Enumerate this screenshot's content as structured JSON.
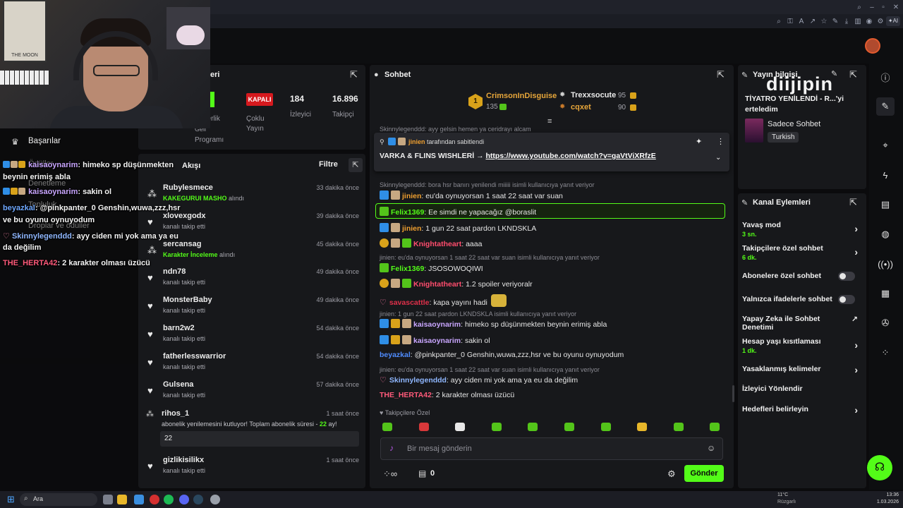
{
  "colors": {
    "accent": "#53fc18",
    "kapali": "#d6191e",
    "mod": "#2f8ee6",
    "vip": "#d9a21a"
  },
  "overlay": {
    "achievements": "Başarılar",
    "menu_faded": [
      "Ödüller",
      "Denetleme",
      "Topluluk",
      "Droplar ve ödüller"
    ],
    "chat": [
      {
        "user": "kaisaoynarim",
        "text": ": himeko sp düşünmekten",
        "cont": "beynin erimiş abla",
        "color": "#c9a6ff"
      },
      {
        "user": "kaisaoynarim",
        "text": ": sakin ol",
        "color": "#c9a6ff"
      },
      {
        "user": "beyazkal",
        "text": ": @pinkpanter_0 Genshin,wuwa,zzz,hsr",
        "cont": "ve bu oyunu oynuyodum",
        "color": "#6fa8ff"
      },
      {
        "user": "Skinnylegenddd",
        "text": ": ayy ciden mi yok ama ya eu",
        "cont": "da değilim",
        "color": "#8fb7ff"
      },
      {
        "user": "THE_HERTA42",
        "text": ": 2 karakter olması üzücü",
        "color": "#ff5a7a"
      }
    ]
  },
  "stats": {
    "title_partial": "eri",
    "partner_lines": [
      "nerlik",
      "Geli",
      "Programı"
    ],
    "kapali": "KAPALI",
    "mode_l1": "Çoklu",
    "mode_l2": "Yayın",
    "viewers": "184",
    "viewers_label": "İzleyici",
    "followers": "16.896",
    "followers_label": "Takipçi"
  },
  "activity": {
    "title": "Akışı",
    "filter": "Filtre",
    "items": [
      {
        "name": "Rubylesmece",
        "sub": "KAKEGURUI MASHO",
        "sub2": " alındı",
        "time": "33 dakika önce",
        "icon": "reward"
      },
      {
        "name": "xlovexgodx",
        "sub": "kanalı takip etti",
        "time": "39 dakika önce",
        "icon": "heart"
      },
      {
        "name": "sercansag",
        "sub": "Karakter İnceleme",
        "sub2": " alındı",
        "time": "45 dakika önce",
        "icon": "reward"
      },
      {
        "name": "ndn78",
        "sub": "kanalı takip etti",
        "time": "49 dakika önce",
        "icon": "heart"
      },
      {
        "name": "MonsterBaby",
        "sub": "kanalı takip etti",
        "time": "49 dakika önce",
        "icon": "heart"
      },
      {
        "name": "barn2w2",
        "sub": "kanalı takip etti",
        "time": "54 dakika önce",
        "icon": "heart"
      },
      {
        "name": "fatherlesswarrior",
        "sub": "kanalı takip etti",
        "time": "54 dakika önce",
        "icon": "heart"
      },
      {
        "name": "Gulsena",
        "sub": "kanalı takip etti",
        "time": "57 dakika önce",
        "icon": "heart"
      }
    ],
    "resub": {
      "name": "rihos_1",
      "time": "1 saat önce",
      "text": "abonelik yenilemesini kutluyor! Toplam abonelik süresi - ",
      "months": "22",
      "suffix": " ay!",
      "msg": "22"
    },
    "last": {
      "name": "gizlikisilikx",
      "sub": "kanalı takip etti",
      "time": "1 saat önce"
    }
  },
  "chat": {
    "title": "Sohbet",
    "top_gifters": [
      {
        "rank": "1",
        "name": "CrimsonInDisguise",
        "amount": "135"
      },
      {
        "name": "Trexxsocute",
        "amount": "95"
      },
      {
        "name": "cqxet",
        "amount": "90"
      }
    ],
    "pinned_by_user": "jinien",
    "pinned_by_text": " tarafından sabitlendi",
    "pinned_text": "VARKA & FLINS WISHLERİ → ",
    "pinned_link": "https://www.youtube.com/watch?v=gaVtViXRfzE",
    "partial_top": "Skinnylegenddd: ayy gelsin hemen ya ceridrayı alcam",
    "messages": [
      {
        "type": "sys",
        "text": "Skinnylegenddd: bora hsr banırı yenilendi miiiii isimli kullanıcıya yanıt veriyor"
      },
      {
        "type": "msg",
        "user": "jinien",
        "ucolor": "#f0a030",
        "text": ": eu'da oynuyorsan 1 saat 22 saat var suan",
        "badges": [
          "mod",
          "og"
        ]
      },
      {
        "type": "hl",
        "user": "Felix1369",
        "ucolor": "#53fc18",
        "text": ": Ee simdi ne yapacağız @boraslit",
        "badges": [
          "sub"
        ]
      },
      {
        "type": "msg",
        "user": "jinien",
        "ucolor": "#f0a030",
        "text": ": 1 gun 22 saat pardon LKNDSKLA",
        "badges": [
          "mod",
          "og"
        ]
      },
      {
        "type": "msg",
        "user": "Knightatheart",
        "ucolor": "#ff4d6d",
        "text": ": aaaa",
        "badges": [
          "one",
          "og",
          "sub"
        ]
      },
      {
        "type": "sys",
        "text": "jinien: eu'da oynuyorsan 1 saat 22 saat var suan isimli kullanıcıya yanıt veriyor"
      },
      {
        "type": "msg",
        "user": "Felix1369",
        "ucolor": "#53fc18",
        "text": ": JSOSOWOQIWI",
        "badges": [
          "sub"
        ]
      },
      {
        "type": "msg",
        "user": "Knightatheart",
        "ucolor": "#ff4d6d",
        "text": ": 1.2 spoiler veriyoralr",
        "badges": [
          "one",
          "og",
          "sub"
        ]
      },
      {
        "type": "msg",
        "user": "savascattle",
        "ucolor": "#e0304a",
        "text": ": kapa yayını hadi",
        "badges": [
          "bow"
        ]
      },
      {
        "type": "sys",
        "text": "jinien: 1 gun 22 saat pardon LKNDSKLA isimli kullanıcıya yanıt veriyor"
      },
      {
        "type": "msg",
        "user": "kaisaoynarim",
        "ucolor": "#c9a6ff",
        "text": ": himeko sp düşünmekten beynin erimiş abla",
        "badges": [
          "mod",
          "vip",
          "og"
        ]
      },
      {
        "type": "msg",
        "user": "kaisaoynarim",
        "ucolor": "#c9a6ff",
        "text": ": sakin ol",
        "badges": [
          "mod",
          "vip",
          "og"
        ]
      },
      {
        "type": "msg",
        "user": "beyazkal",
        "ucolor": "#4f8cff",
        "text": ": @pinkpanter_0 Genshin,wuwa,zzz,hsr ve bu oyunu oynuyodum",
        "badges": []
      },
      {
        "type": "sys",
        "text": "jinien: eu'da oynuyorsan 1 saat 22 saat var suan isimli kullanıcıya yanıt veriyor"
      },
      {
        "type": "msg",
        "user": "Skinnylegenddd",
        "ucolor": "#8fb7ff",
        "text": ": ayy ciden mi yok ama ya eu da değilim",
        "badges": [
          "bow"
        ]
      },
      {
        "type": "msg",
        "user": "THE_HERTA42",
        "ucolor": "#ff5a7a",
        "text": ": 2 karakter olması üzücü",
        "badges": []
      }
    ],
    "emote_section": "Takipçilere Özel",
    "input_placeholder": "Bir mesaj gönderin",
    "points": "0",
    "send": "Gönder"
  },
  "stream_info": {
    "title": "Yayın bilgisi",
    "stream_title": "TİYATRO YENİLENDİ - R...'yi",
    "stream_title2": "erteledim",
    "category": "Sadece Sohbet",
    "language": "Turkish",
    "watermark": "diijipin"
  },
  "channel_actions": {
    "title": "Kanal Eylemleri",
    "items": [
      {
        "label": "Yavaş mod",
        "sub": "3 sn.",
        "control": "chevron"
      },
      {
        "label": "Takipçilere özel sohbet",
        "sub": "6 dk.",
        "control": "chevron"
      },
      {
        "label": "Abonelere özel sohbet",
        "control": "toggle"
      },
      {
        "label": "Yalnızca ifadelerle sohbet",
        "control": "toggle"
      },
      {
        "label": "Yapay Zeka ile Sohbet",
        "label2": "Denetimi",
        "control": "external"
      },
      {
        "label": "Hesap yaşı kısıtlaması",
        "sub": "1 dk.",
        "control": "chevron"
      },
      {
        "label": "Yasaklanmış kelimeler",
        "control": "chevron"
      },
      {
        "label": "İzleyici Yönlendir",
        "control": "none"
      },
      {
        "label": "Hedefleri belirleyin",
        "control": "chevron"
      }
    ]
  },
  "taskbar": {
    "search": "Ara",
    "temp": "11°C",
    "weather": "Rüzgarlı",
    "time": "13:36",
    "date": "1.03.2026"
  }
}
